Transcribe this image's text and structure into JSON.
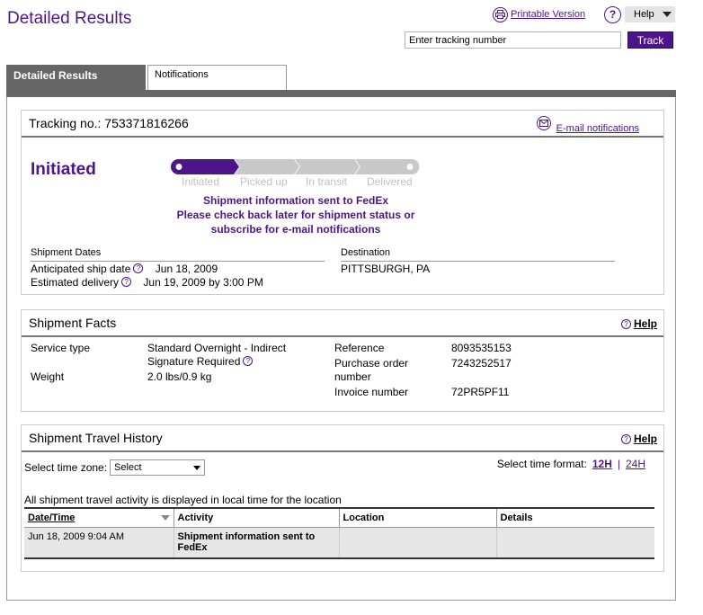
{
  "page": {
    "title": "Detailed Results"
  },
  "header": {
    "printable_label": "Printable Version",
    "help_label": "Help",
    "tracking_input_value": "Enter tracking number",
    "track_button": "Track"
  },
  "tabs": [
    {
      "label": "Detailed Results",
      "active": true
    },
    {
      "label": "Notifications",
      "active": false
    }
  ],
  "summary": {
    "tracking_label": "Tracking no.:",
    "tracking_number": "753371816266",
    "email_link": "E-mail notifications",
    "status": "Initiated",
    "progress_steps": [
      "Initiated",
      "Picked up",
      "In transit",
      "Delivered"
    ],
    "current_step": 1,
    "message": [
      "Shipment information sent to FedEx",
      "Please check back later for shipment status or",
      "subscribe for e-mail notifications"
    ],
    "dates_heading": "Shipment Dates",
    "anticipated_label": "Anticipated ship date",
    "anticipated_value": "Jun 18, 2009",
    "estimated_label": "Estimated delivery",
    "estimated_value": "Jun 19, 2009 by 3:00 PM",
    "destination_heading": "Destination",
    "destination_value": "PITTSBURGH, PA"
  },
  "facts": {
    "heading": "Shipment Facts",
    "help_label": "Help",
    "service_type_label": "Service type",
    "service_type_value": "Standard Overnight - Indirect",
    "signature_value": "Signature Required",
    "weight_label": "Weight",
    "weight_value": "2.0 lbs/0.9 kg",
    "reference_label": "Reference",
    "reference_value": "8093535153",
    "po_label_1": "Purchase order",
    "po_label_2": "number",
    "po_value": "7243252517",
    "invoice_label": "Invoice number",
    "invoice_value": "72PR5PF11"
  },
  "history": {
    "heading": "Shipment Travel History",
    "help_label": "Help",
    "timezone_label": "Select time zone:",
    "timezone_value": "Select",
    "time_format_label": "Select time format:",
    "format_12h": "12H",
    "format_24h": "24H",
    "format_sep": "|",
    "note": "All shipment travel activity is displayed in local time for the location",
    "columns": [
      "Date/Time",
      "Activity",
      "Location",
      "Details"
    ],
    "rows": [
      {
        "datetime": "Jun 18, 2009 9:04 AM",
        "activity": "Shipment information sent to FedEx",
        "location": "",
        "details": ""
      }
    ]
  },
  "colors": {
    "brand_purple": "#4d148c",
    "tab_gray": "#666666",
    "row_gray": "#e6e6e6"
  }
}
